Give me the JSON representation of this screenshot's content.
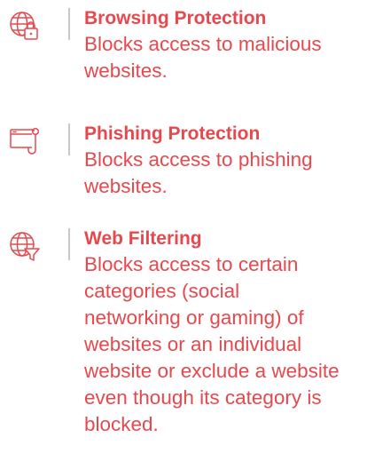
{
  "colors": {
    "accent": "#e6484d",
    "divider": "#c8c8c8",
    "background": "#ffffff"
  },
  "features": [
    {
      "icon": "globe-lock-icon",
      "title": "Browsing Protection",
      "description": "Blocks access to malicious\nwebsites."
    },
    {
      "icon": "phishing-hook-icon",
      "title": "Phishing Protection",
      "description": "Blocks access to phishing\nwebsites."
    },
    {
      "icon": "globe-filter-icon",
      "title": "Web Filtering",
      "description": "Blocks access to certain\ncategories (social\nnetworking or gaming) of\nwebsites or an individual\nwebsite or exclude a website\neven though its category is\nblocked."
    }
  ]
}
